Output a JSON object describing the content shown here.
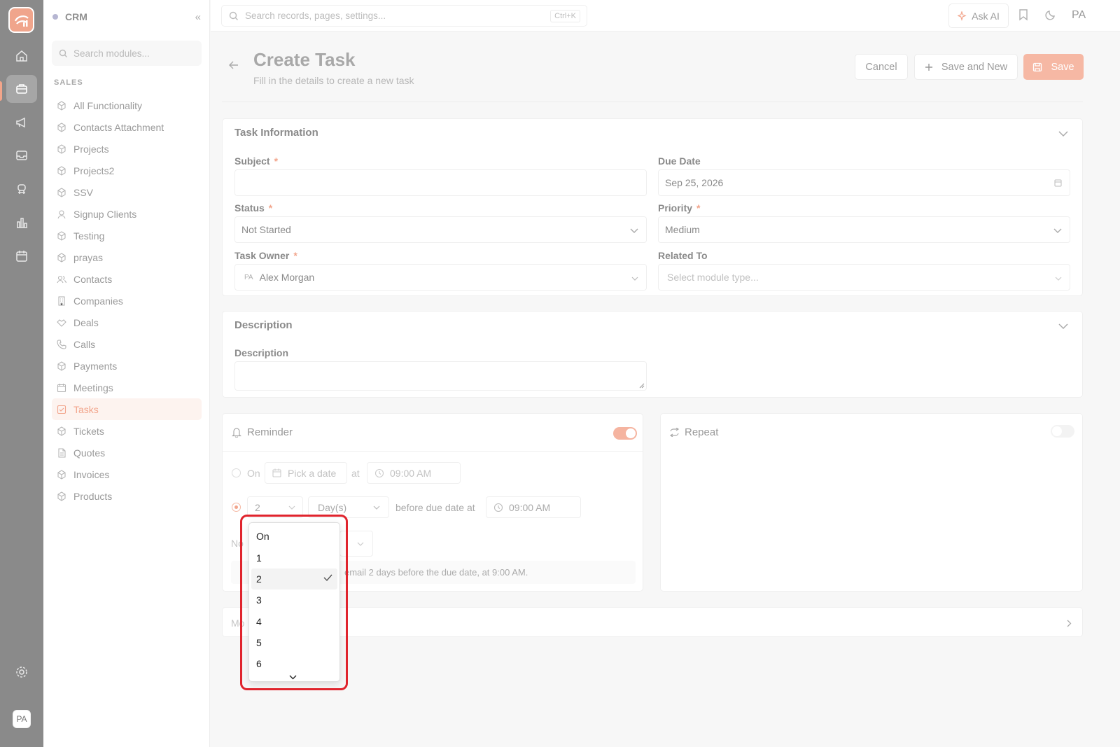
{
  "rail": {
    "avatar": "PA"
  },
  "sidebar": {
    "app_name": "CRM",
    "search_placeholder": "Search modules...",
    "section": "SALES",
    "items": [
      {
        "label": "All Functionality",
        "icon": "cube-icon"
      },
      {
        "label": "Contacts Attachment",
        "icon": "cube-icon"
      },
      {
        "label": "Projects",
        "icon": "cube-icon"
      },
      {
        "label": "Projects2",
        "icon": "cube-icon"
      },
      {
        "label": "SSV",
        "icon": "cube-icon"
      },
      {
        "label": "Signup Clients",
        "icon": "user-icon"
      },
      {
        "label": "Testing",
        "icon": "cube-icon"
      },
      {
        "label": "prayas",
        "icon": "cube-icon"
      },
      {
        "label": "Contacts",
        "icon": "users-icon"
      },
      {
        "label": "Companies",
        "icon": "building-icon"
      },
      {
        "label": "Deals",
        "icon": "handshake-icon"
      },
      {
        "label": "Calls",
        "icon": "phone-icon"
      },
      {
        "label": "Payments",
        "icon": "cube-icon"
      },
      {
        "label": "Meetings",
        "icon": "calendar-icon"
      },
      {
        "label": "Tasks",
        "icon": "checkbox-icon",
        "active": true
      },
      {
        "label": "Tickets",
        "icon": "cube-icon"
      },
      {
        "label": "Quotes",
        "icon": "document-icon"
      },
      {
        "label": "Invoices",
        "icon": "cube-icon"
      },
      {
        "label": "Products",
        "icon": "cube-icon"
      }
    ]
  },
  "topbar": {
    "search_placeholder": "Search records, pages, settings...",
    "shortcut": "Ctrl+K",
    "ask_ai": "Ask AI",
    "user_initials": "PA"
  },
  "header": {
    "title": "Create Task",
    "subtitle": "Fill in the details to create a new task",
    "cancel": "Cancel",
    "save_and_new": "Save and New",
    "save": "Save"
  },
  "task_info": {
    "title": "Task Information",
    "subject_label": "Subject",
    "subject_value": "",
    "due_date_label": "Due Date",
    "due_date_value": "Sep 25, 2026",
    "status_label": "Status",
    "status_value": "Not Started",
    "priority_label": "Priority",
    "priority_value": "Medium",
    "owner_label": "Task Owner",
    "owner_initials": "PA",
    "owner_value": "Alex Morgan",
    "related_label": "Related To",
    "related_placeholder": "Select module type..."
  },
  "description": {
    "title": "Description",
    "field_label": "Description"
  },
  "reminder": {
    "title": "Reminder",
    "enabled": true,
    "on_label": "On",
    "pick_date": "Pick a date",
    "at": "at",
    "time1": "09:00 AM",
    "count": "2",
    "unit": "Day(s)",
    "before_text": "before due date at",
    "time2": "09:00 AM",
    "notify_partial": "No",
    "summary_partial": "email 2 days before the due date, at 9:00 AM."
  },
  "repeat": {
    "title": "Repeat",
    "enabled": false
  },
  "more_partial": "Mo",
  "dropdown": {
    "options": [
      "On",
      "1",
      "2",
      "3",
      "4",
      "5",
      "6"
    ],
    "selected": "2"
  },
  "colors": {
    "accent": "#F2A58C",
    "highlight": "#E0242D",
    "rail": "#8A8A8A"
  }
}
